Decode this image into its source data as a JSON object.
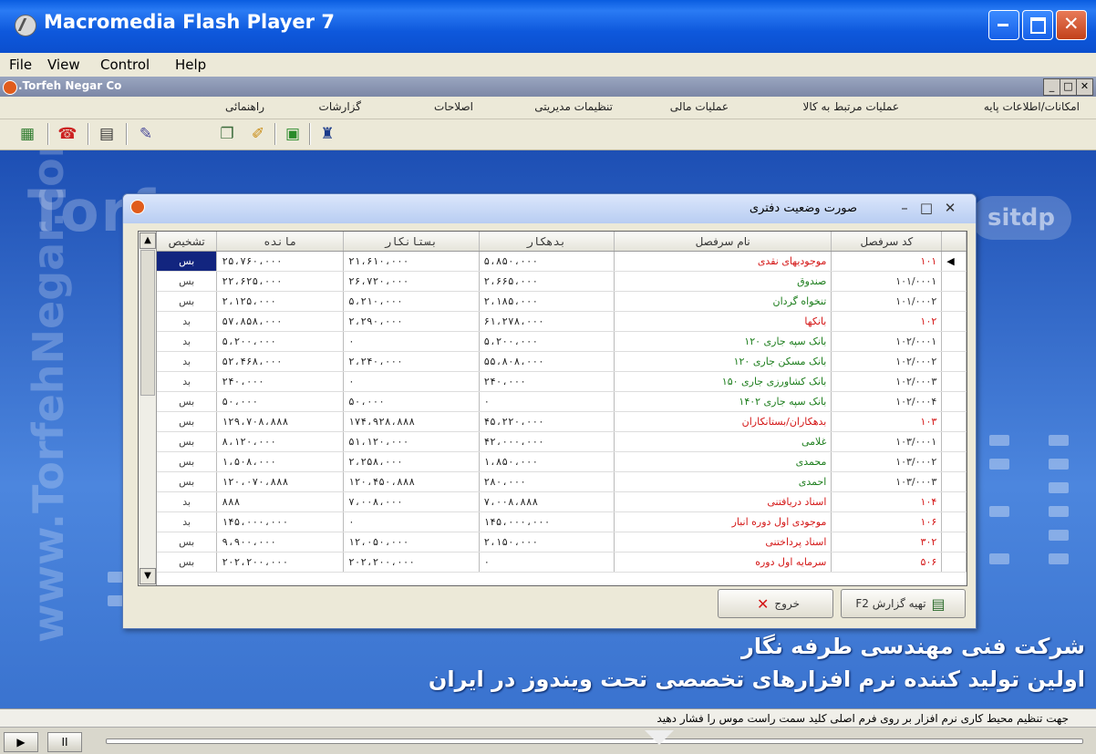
{
  "window": {
    "title": "Macromedia Flash Player 7",
    "controls": {
      "minimize": "_",
      "maximize": "□",
      "close": "✕"
    }
  },
  "menubar": {
    "items": [
      "File",
      "View",
      "Control",
      "Help"
    ]
  },
  "inner_window": {
    "title": ".Torfeh Negar Co",
    "controls": {
      "minimize": "_",
      "maximize": "□",
      "close": "✕"
    }
  },
  "app_menu": [
    "امکانات/اطلاعات پایه",
    "عملیات مرتبط به کالا",
    "عملیات مالی",
    "تنظیمات مدیریتی",
    "اصلاحات",
    "گزارشات",
    "راهنمائی"
  ],
  "toolbar_icons": [
    "calculator-icon",
    "phone-icon",
    "notepad-icon",
    "document-icon",
    "forms-icon",
    "folder-icon",
    "window-icon",
    "exit-icon"
  ],
  "dialog": {
    "title": "صورت وضعیت دفتری",
    "columns": {
      "status": "تشخیص",
      "balance": "مانده",
      "credit": "بستانکار",
      "debit": "بدهکار",
      "name": "نام سرفصل",
      "code": "کد سرفصل"
    },
    "rows": [
      {
        "code": "۱۰۱",
        "name": "موجودیهای نقدی",
        "debit": "۵،۸۵۰،۰۰۰",
        "credit": "۲۱،۶۱۰،۰۰۰",
        "balance": "۲۵،۷۶۰،۰۰۰",
        "status": "بس",
        "type": "red",
        "selected": true
      },
      {
        "code": "۱۰۱/۰۰۰۱",
        "name": "صندوق",
        "debit": "۲،۶۶۵،۰۰۰",
        "credit": "۲۶،۷۲۰،۰۰۰",
        "balance": "۲۲،۶۲۵،۰۰۰",
        "status": "بس",
        "type": "green"
      },
      {
        "code": "۱۰۱/۰۰۰۲",
        "name": "تنخواه گردان",
        "debit": "۲،۱۸۵،۰۰۰",
        "credit": "۵،۲۱۰،۰۰۰",
        "balance": "۲،۱۲۵،۰۰۰",
        "status": "بس",
        "type": "green"
      },
      {
        "code": "۱۰۲",
        "name": "بانکها",
        "debit": "۶۱،۲۷۸،۰۰۰",
        "credit": "۲،۲۹۰،۰۰۰",
        "balance": "۵۷،۸۵۸،۰۰۰",
        "status": "بد",
        "type": "red"
      },
      {
        "code": "۱۰۲/۰۰۰۱",
        "name": "بانک سپه جاری ۱۲۰",
        "debit": "۵،۲۰۰،۰۰۰",
        "credit": "۰",
        "balance": "۵،۲۰۰،۰۰۰",
        "status": "بد",
        "type": "green"
      },
      {
        "code": "۱۰۲/۰۰۰۲",
        "name": "بانک مسکن جاری ۱۲۰",
        "debit": "۵۵،۸۰۸،۰۰۰",
        "credit": "۲،۲۴۰،۰۰۰",
        "balance": "۵۲،۴۶۸،۰۰۰",
        "status": "بد",
        "type": "green"
      },
      {
        "code": "۱۰۲/۰۰۰۳",
        "name": "بانک کشاورزی جاری ۱۵۰",
        "debit": "۲۴۰،۰۰۰",
        "credit": "۰",
        "balance": "۲۴۰،۰۰۰",
        "status": "بد",
        "type": "green"
      },
      {
        "code": "۱۰۲/۰۰۰۴",
        "name": "بانک سپه جاری ۱۴۰۲",
        "debit": "۰",
        "credit": "۵۰،۰۰۰",
        "balance": "۵۰،۰۰۰",
        "status": "بس",
        "type": "green"
      },
      {
        "code": "۱۰۳",
        "name": "بدهکاران/بستانکاران",
        "debit": "۴۵،۲۲۰،۰۰۰",
        "credit": "۱۷۴،۹۲۸،۸۸۸",
        "balance": "۱۲۹،۷۰۸،۸۸۸",
        "status": "بس",
        "type": "red"
      },
      {
        "code": "۱۰۳/۰۰۰۱",
        "name": "غلامی",
        "debit": "۴۲،۰۰۰،۰۰۰",
        "credit": "۵۱،۱۲۰،۰۰۰",
        "balance": "۸،۱۲۰،۰۰۰",
        "status": "بس",
        "type": "green"
      },
      {
        "code": "۱۰۳/۰۰۰۲",
        "name": "محمدی",
        "debit": "۱،۸۵۰،۰۰۰",
        "credit": "۲،۲۵۸،۰۰۰",
        "balance": "۱،۵۰۸،۰۰۰",
        "status": "بس",
        "type": "green"
      },
      {
        "code": "۱۰۳/۰۰۰۳",
        "name": "احمدی",
        "debit": "۲۸۰،۰۰۰",
        "credit": "۱۲۰،۴۵۰،۸۸۸",
        "balance": "۱۲۰،۰۷۰،۸۸۸",
        "status": "بس",
        "type": "green"
      },
      {
        "code": "۱۰۴",
        "name": "اسناد دریافتنی",
        "debit": "۷،۰۰۸،۸۸۸",
        "credit": "۷،۰۰۸،۰۰۰",
        "balance": "۸۸۸",
        "status": "بد",
        "type": "red"
      },
      {
        "code": "۱۰۶",
        "name": "موجودی اول دوره انبار",
        "debit": "۱۴۵،۰۰۰،۰۰۰",
        "credit": "۰",
        "balance": "۱۴۵،۰۰۰،۰۰۰",
        "status": "بد",
        "type": "red"
      },
      {
        "code": "۳۰۲",
        "name": "اسناد پرداختنی",
        "debit": "۲،۱۵۰،۰۰۰",
        "credit": "۱۲،۰۵۰،۰۰۰",
        "balance": "۹،۹۰۰،۰۰۰",
        "status": "بس",
        "type": "red"
      },
      {
        "code": "۵۰۶",
        "name": "سرمایه اول دوره",
        "debit": "۰",
        "credit": "۲۰۲،۲۰۰،۰۰۰",
        "balance": "۲۰۲،۲۰۰،۰۰۰",
        "status": "بس",
        "type": "red"
      }
    ],
    "buttons": {
      "report": "تهیه گزارش F2",
      "exit": "خروج"
    }
  },
  "background": {
    "watermark_top": "Torf",
    "watermark_side": "www.TorfehNegar.com",
    "watermark_right": "sitdp",
    "company": "شرکت فنی مهندسی طرفه نگار",
    "tagline": "اولین تولید کننده نرم افزارهای تخصصی تحت ویندوز در ایران"
  },
  "statusbar": {
    "text": "جهت تنظیم محیط کاری نرم افزار بر روی فرم اصلی کلید سمت راست موس را فشار دهید"
  },
  "player": {
    "play": "▶",
    "pause": "II"
  },
  "colors": {
    "titlebar": "#0b4fce",
    "workspace": "#2e63c4",
    "header_red": "#d41616",
    "item_green": "#1c7d1c",
    "selected": "#12257f"
  }
}
